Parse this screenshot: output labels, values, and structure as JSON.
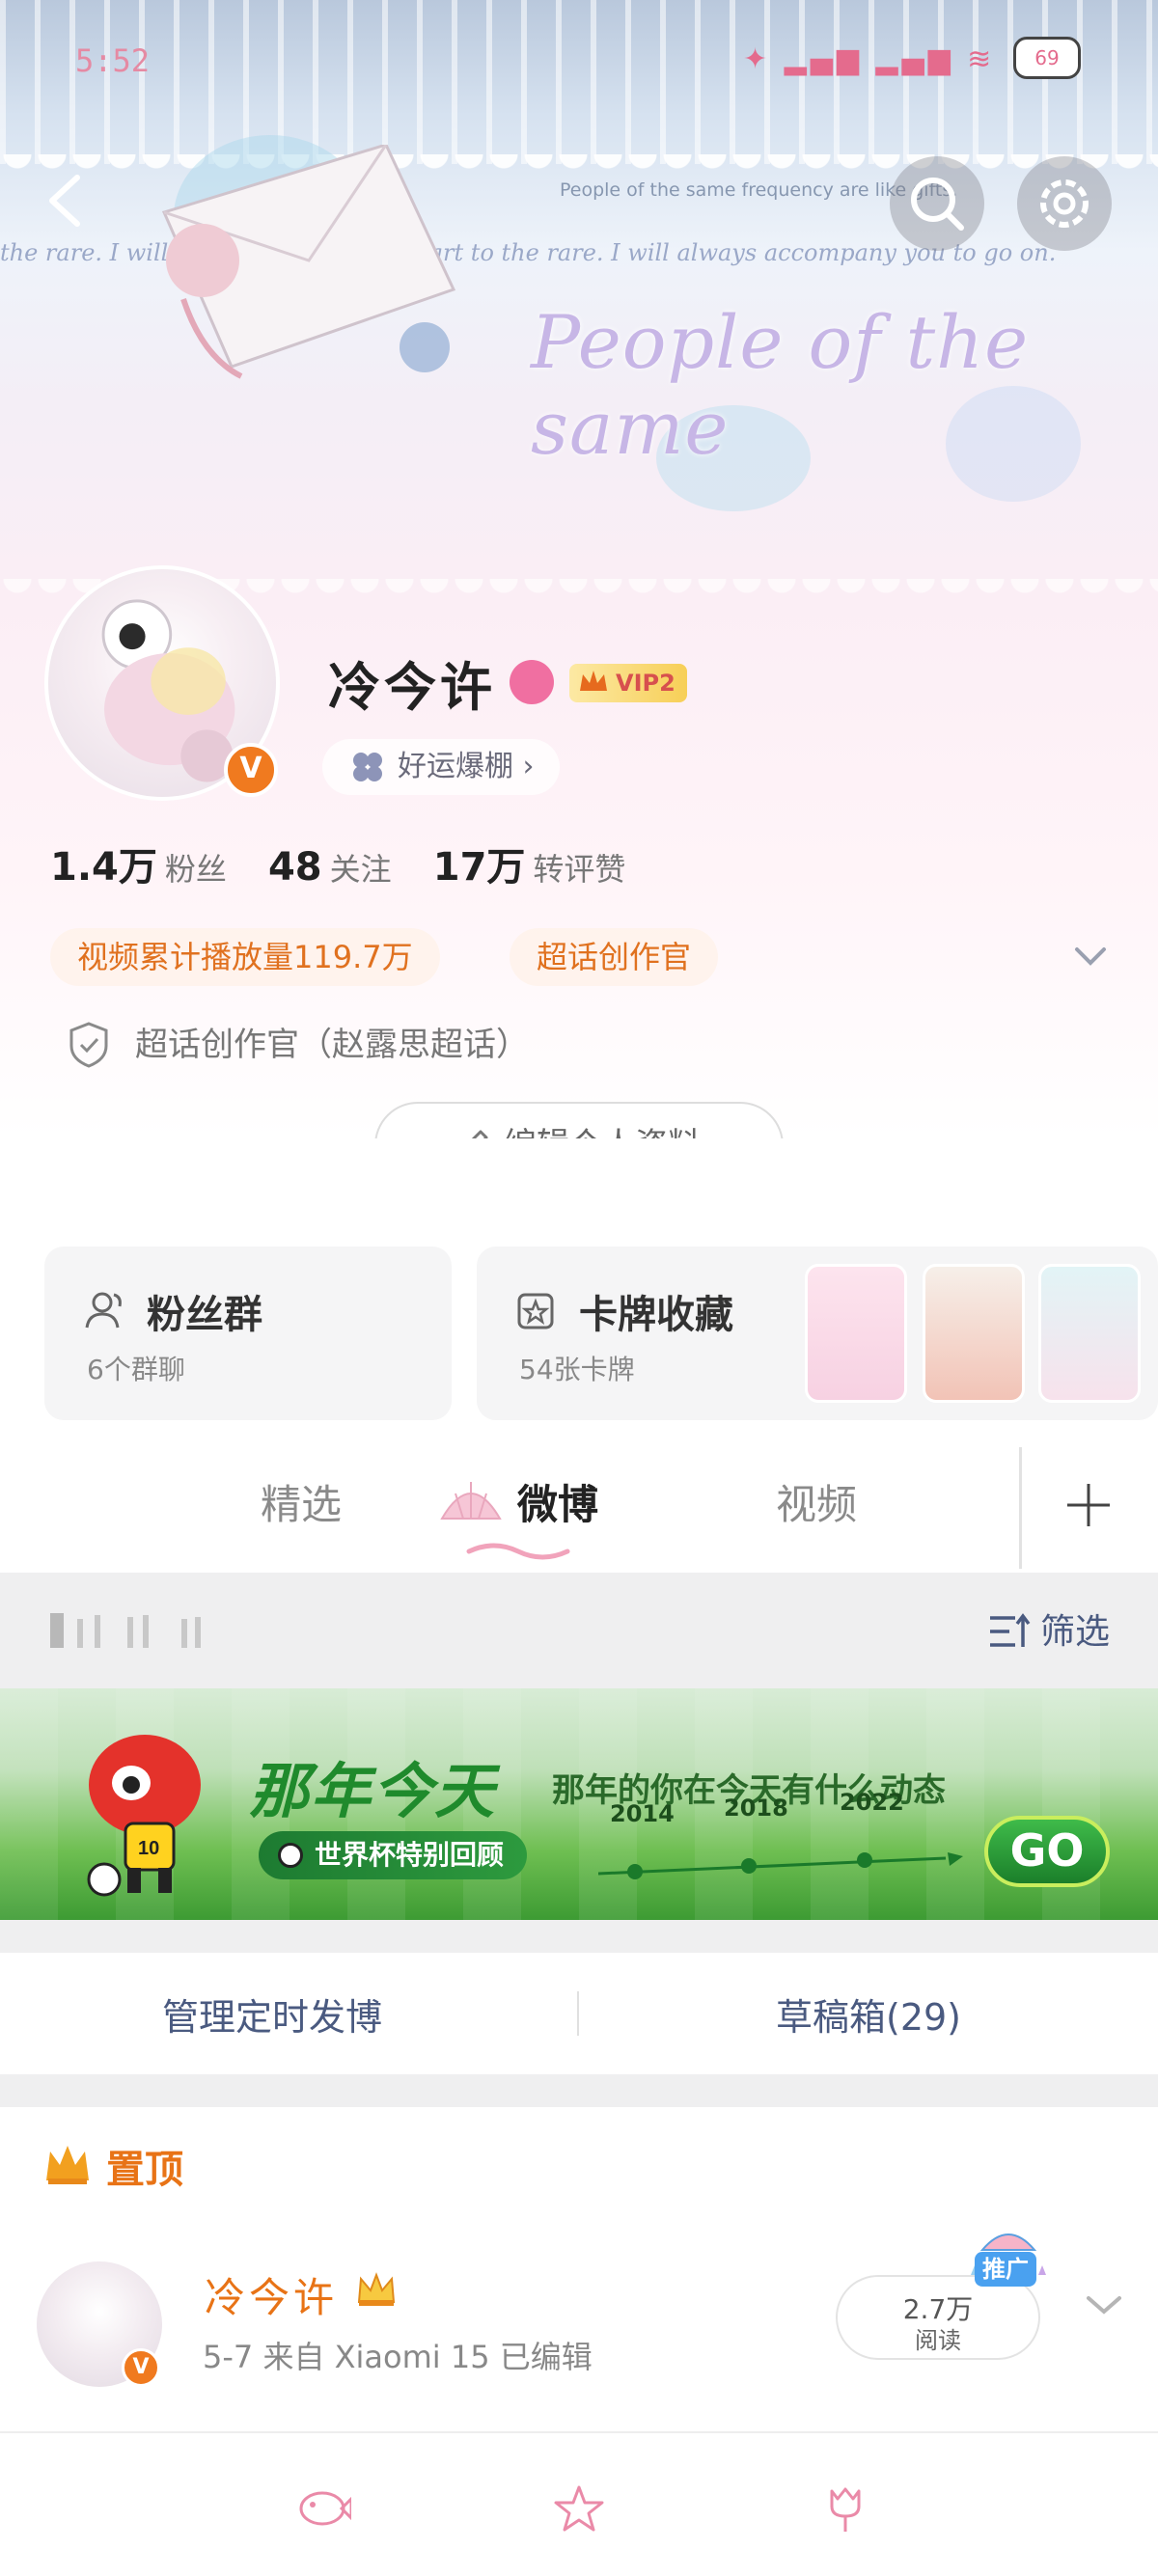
{
  "status_bar": {
    "time": "5:52",
    "battery": "69"
  },
  "banner": {
    "subtitle": "People of the same frequency are like gifts.",
    "script_line": "the rare. I will always... From the heart to the rare. I will always accompany you to go on.",
    "title": "People of the same"
  },
  "profile": {
    "name": "冷今许",
    "vip_label": "VIP2",
    "luck_label": "好运爆棚",
    "stats": [
      {
        "num": "1.4万",
        "label": "粉丝"
      },
      {
        "num": "48",
        "label": "关注"
      },
      {
        "num": "17万",
        "label": "转评赞"
      }
    ],
    "tags": [
      "视频累计播放量119.7万",
      "超话创作官"
    ],
    "certification": "超话创作官（赵露思超话）",
    "edit_label": "编辑个人资料"
  },
  "cards": {
    "fans_title": "粉丝群",
    "fans_sub": "6个群聊",
    "collection_title": "卡牌收藏",
    "collection_sub": "54张卡牌"
  },
  "tabs": {
    "items": [
      "精选",
      "微博",
      "视频"
    ],
    "active": "微博"
  },
  "filter_label": "筛选",
  "promo": {
    "title": "那年今天",
    "subtitle": "那年的你在今天有什么动态",
    "pill": "世界杯特别回顾",
    "years": [
      "2014",
      "2018",
      "2022"
    ],
    "go": "GO"
  },
  "actions": {
    "scheduled": "管理定时发博",
    "drafts": "草稿箱(29)"
  },
  "pinned": {
    "label": "置顶",
    "author": "冷今许",
    "meta": "5-7  来自 Xiaomi 15   已编辑",
    "reads_num": "2.7万",
    "reads_label": "阅读",
    "promo_badge": "推广"
  },
  "colors": {
    "accent": "#e87316",
    "vip_gold": "#f7cf57",
    "link": "#4a5a80",
    "pink": "#f06fa1"
  }
}
